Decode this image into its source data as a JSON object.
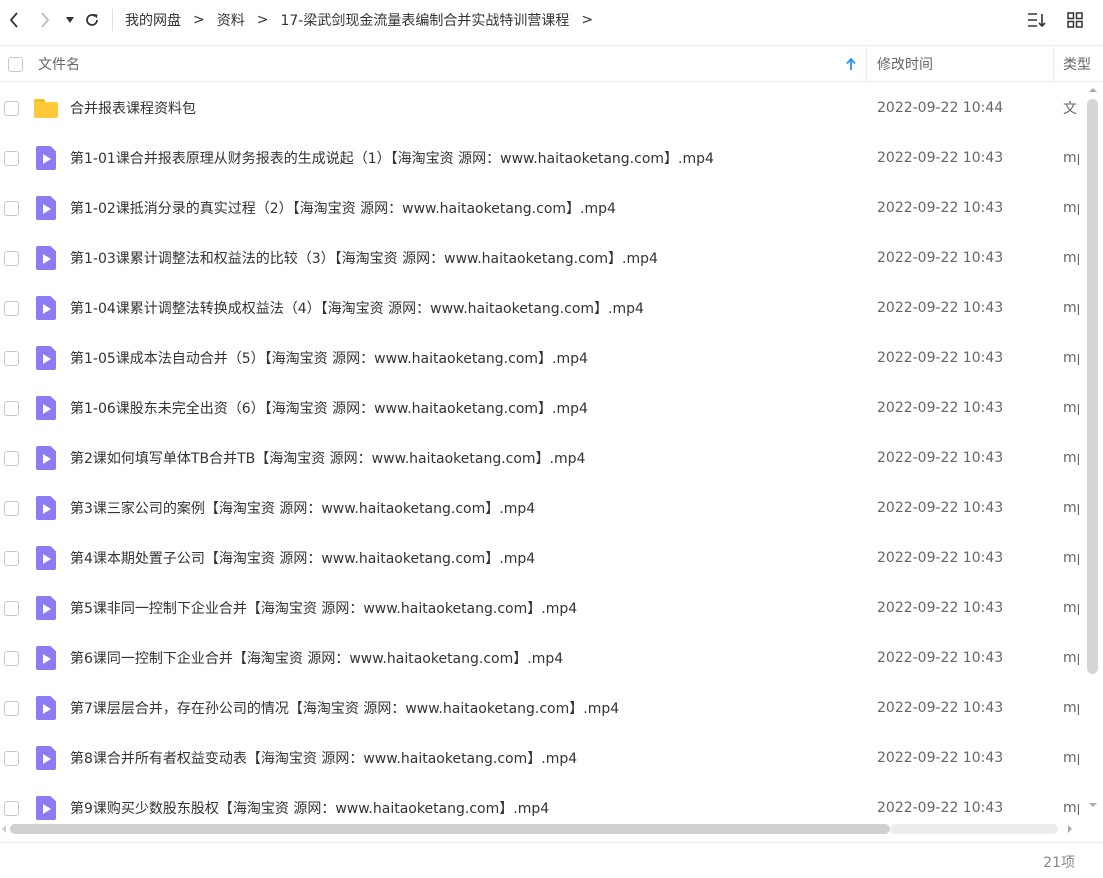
{
  "nav": {
    "icons": [
      "back-arrow-icon",
      "forward-arrow-icon",
      "dropdown-caret-icon",
      "refresh-icon"
    ],
    "breadcrumb": [
      "我的网盘",
      "资料",
      "17-梁武剑现金流量表编制合并实战特训营课程"
    ],
    "separator": ">",
    "right_icons": [
      "sort-list-icon",
      "grid-view-icon"
    ]
  },
  "columns": {
    "name": "文件名",
    "time": "修改时间",
    "type": "类型",
    "sorted_by": "name",
    "sort_direction": "ascending"
  },
  "files": [
    {
      "icon": "folder-icon",
      "name": "合并报表课程资料包",
      "time": "2022-09-22 10:44",
      "type": "文"
    },
    {
      "icon": "video-file-icon",
      "name": "第1-01课合并报表原理从财务报表的生成说起（1）【海淘宝资 源网：www.haitaoketang.com】.mp4",
      "time": "2022-09-22 10:43",
      "type": "mp"
    },
    {
      "icon": "video-file-icon",
      "name": "第1-02课抵消分录的真实过程（2）【海淘宝资 源网：www.haitaoketang.com】.mp4",
      "time": "2022-09-22 10:43",
      "type": "mp"
    },
    {
      "icon": "video-file-icon",
      "name": "第1-03课累计调整法和权益法的比较（3）【海淘宝资 源网：www.haitaoketang.com】.mp4",
      "time": "2022-09-22 10:43",
      "type": "mp"
    },
    {
      "icon": "video-file-icon",
      "name": "第1-04课累计调整法转换成权益法（4）【海淘宝资 源网：www.haitaoketang.com】.mp4",
      "time": "2022-09-22 10:43",
      "type": "mp"
    },
    {
      "icon": "video-file-icon",
      "name": "第1-05课成本法自动合并（5）【海淘宝资 源网：www.haitaoketang.com】.mp4",
      "time": "2022-09-22 10:43",
      "type": "mp"
    },
    {
      "icon": "video-file-icon",
      "name": "第1-06课股东未完全出资（6）【海淘宝资 源网：www.haitaoketang.com】.mp4",
      "time": "2022-09-22 10:43",
      "type": "mp"
    },
    {
      "icon": "video-file-icon",
      "name": "第2课如何填写单体TB合并TB【海淘宝资 源网：www.haitaoketang.com】.mp4",
      "time": "2022-09-22 10:43",
      "type": "mp"
    },
    {
      "icon": "video-file-icon",
      "name": "第3课三家公司的案例【海淘宝资 源网：www.haitaoketang.com】.mp4",
      "time": "2022-09-22 10:43",
      "type": "mp"
    },
    {
      "icon": "video-file-icon",
      "name": "第4课本期处置子公司【海淘宝资 源网：www.haitaoketang.com】.mp4",
      "time": "2022-09-22 10:43",
      "type": "mp"
    },
    {
      "icon": "video-file-icon",
      "name": "第5课非同一控制下企业合并【海淘宝资 源网：www.haitaoketang.com】.mp4",
      "time": "2022-09-22 10:43",
      "type": "mp"
    },
    {
      "icon": "video-file-icon",
      "name": "第6课同一控制下企业合并【海淘宝资 源网：www.haitaoketang.com】.mp4",
      "time": "2022-09-22 10:43",
      "type": "mp"
    },
    {
      "icon": "video-file-icon",
      "name": "第7课层层合并，存在孙公司的情况【海淘宝资 源网：www.haitaoketang.com】.mp4",
      "time": "2022-09-22 10:43",
      "type": "mp"
    },
    {
      "icon": "video-file-icon",
      "name": "第8课合并所有者权益变动表【海淘宝资 源网：www.haitaoketang.com】.mp4",
      "time": "2022-09-22 10:43",
      "type": "mp"
    },
    {
      "icon": "video-file-icon",
      "name": "第9课购买少数股东股权【海淘宝资 源网：www.haitaoketang.com】.mp4",
      "time": "2022-09-22 10:43",
      "type": "mp"
    }
  ],
  "footer": {
    "count": "21项"
  },
  "colors": {
    "folder": "#ffca3a",
    "video_icon": "#8c7cf3",
    "sort_arrow": "#2196f3"
  }
}
